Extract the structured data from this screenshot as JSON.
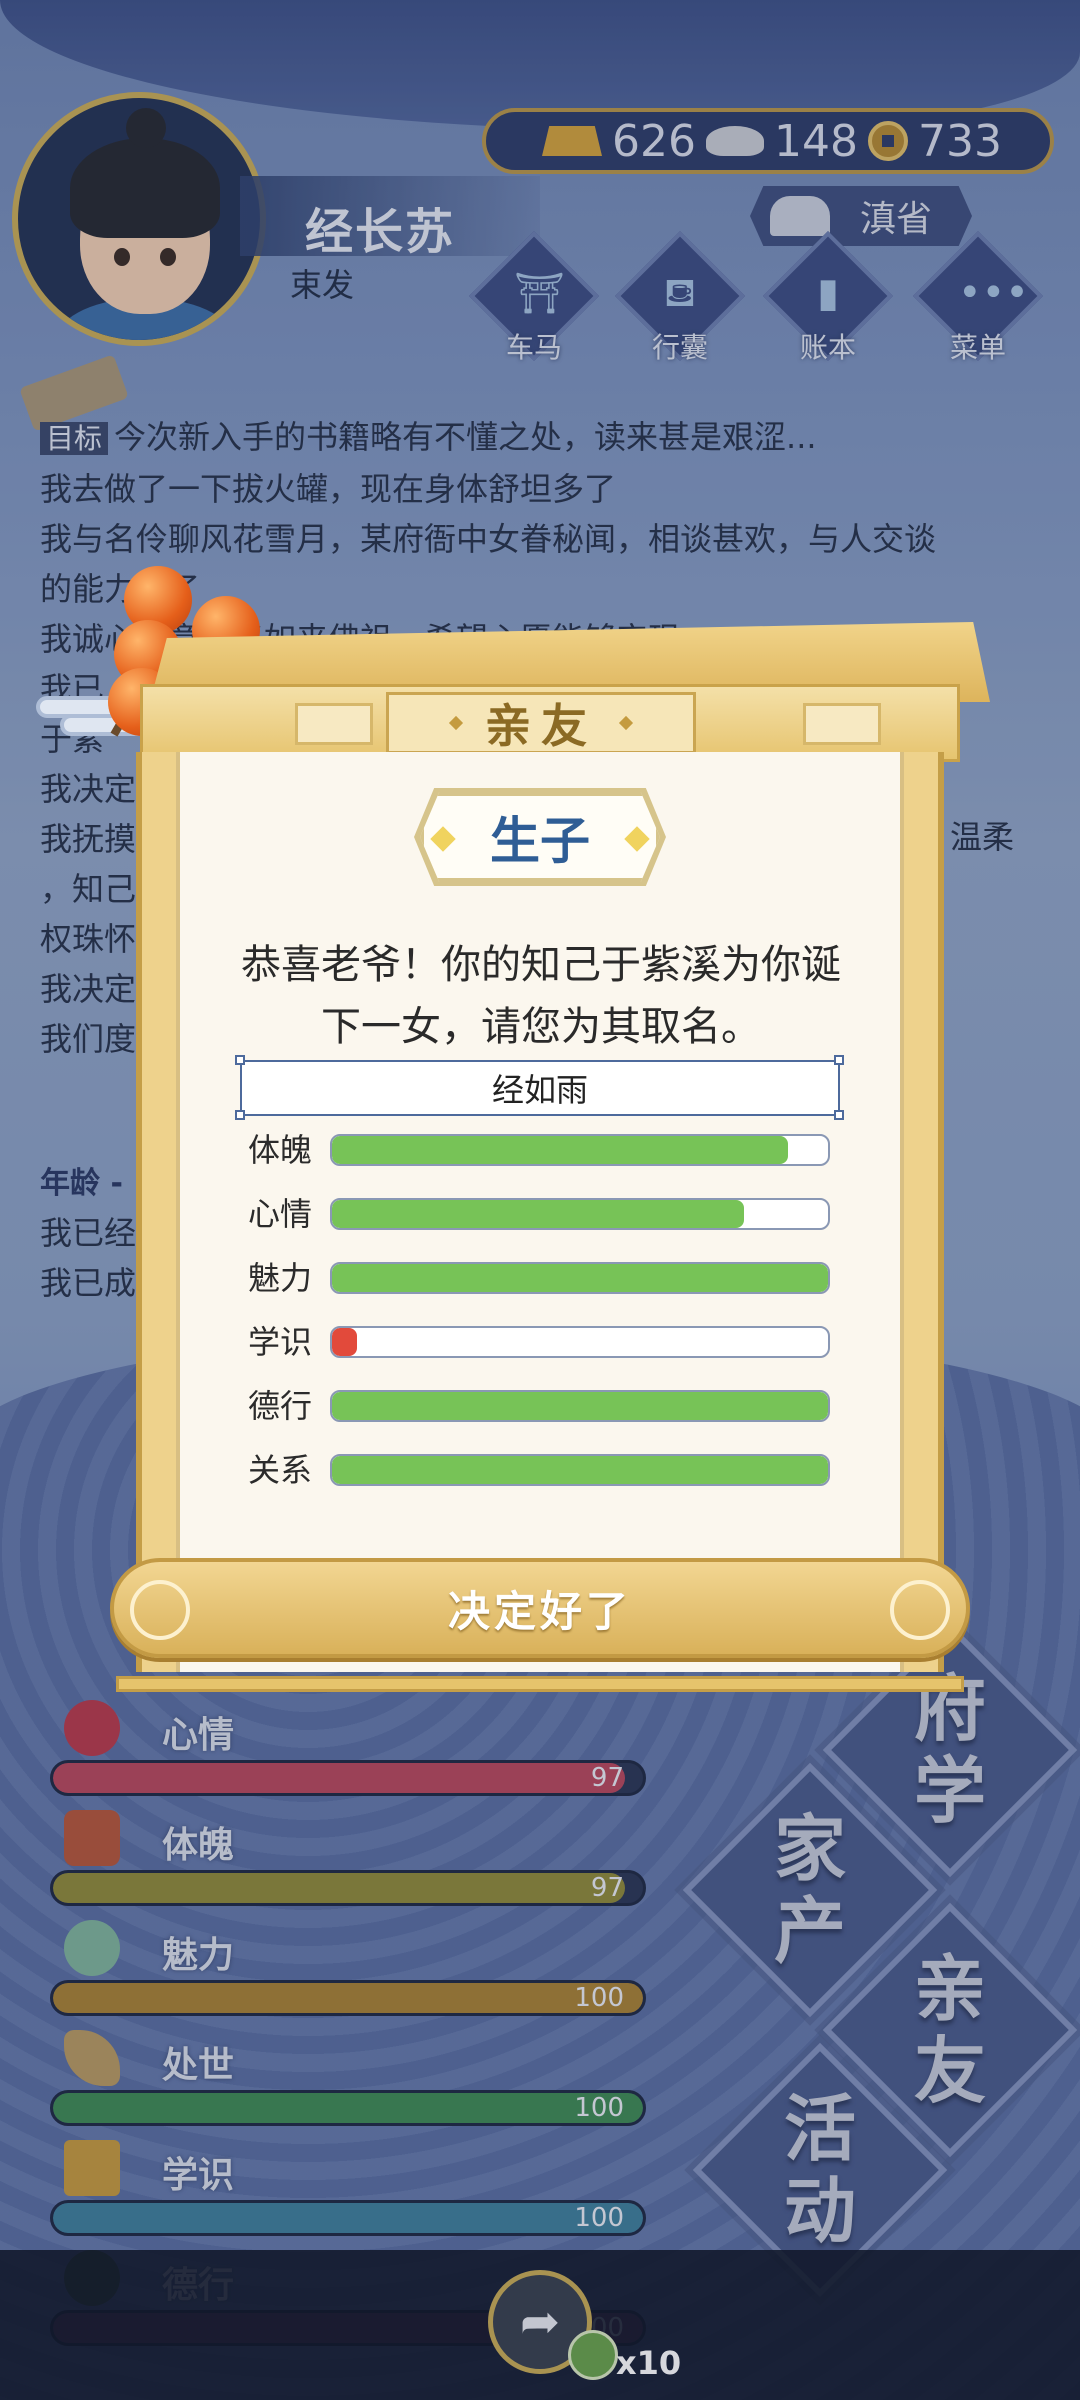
{
  "header": {
    "currency": [
      {
        "icon": "gold-ingot-icon",
        "value": "626"
      },
      {
        "icon": "silver-ingot-icon",
        "value": "148"
      },
      {
        "icon": "copper-coin-icon",
        "value": "733"
      }
    ],
    "character_name": "经长苏",
    "character_subtitle": "束发",
    "region": "滇省",
    "menu_buttons": [
      {
        "label": "车马",
        "icon": "carriage-icon"
      },
      {
        "label": "行囊",
        "icon": "bag-icon"
      },
      {
        "label": "账本",
        "icon": "ledger-icon"
      },
      {
        "label": "菜单",
        "icon": "more-icon"
      }
    ]
  },
  "log": {
    "goal_tag": "目标",
    "lines": [
      "今次新入手的书籍略有不懂之处，读来甚是艰涩...",
      "我去做了一下拔火罐，现在身体舒坦多了",
      "我与名伶聊风花雪月，某府衙中女眷秘闻，相谈甚欢，与人交谈",
      "的能力长了",
      "我诚心诚意拜了如来佛祖，希望心愿能够实现",
      "我已",
      "于紫",
      "我决定",
      "我抚摸",
      "，知己",
      "权珠怀",
      "我决定",
      "我们度"
    ],
    "right_fragment": "温柔",
    "age_heading": "年龄 -",
    "lines2": [
      "我已经",
      "我已成"
    ]
  },
  "stats": [
    {
      "label": "心情",
      "value": "97",
      "percent": 97,
      "color": "#b8485d",
      "icon": "flower-icon"
    },
    {
      "label": "体魄",
      "value": "97",
      "percent": 97,
      "color": "#8f8a3a",
      "icon": "figure-icon"
    },
    {
      "label": "魅力",
      "value": "100",
      "percent": 100,
      "color": "#a88235",
      "icon": "jade-icon"
    },
    {
      "label": "处世",
      "value": "100",
      "percent": 100,
      "color": "#3f8a55",
      "icon": "fan-icon"
    },
    {
      "label": "学识",
      "value": "100",
      "percent": 100,
      "color": "#3f7f9c",
      "icon": "books-icon"
    },
    {
      "label": "德行",
      "value": "100",
      "percent": 100,
      "color": "#6a3b6e",
      "icon": "brush-icon"
    }
  ],
  "nav": [
    {
      "line1": "府",
      "line2": "学"
    },
    {
      "line1": "家",
      "line2": "产"
    },
    {
      "line1": "亲",
      "line2": "友"
    },
    {
      "line1": "活",
      "line2": "动"
    }
  ],
  "share": {
    "count": "x10"
  },
  "modal": {
    "title": "亲友",
    "event": "生子",
    "message_line1": "恭喜老爷！你的知己于紫溪为你诞",
    "message_line2": "下一女，请您为其取名。",
    "name_value": "经如雨",
    "attributes": [
      {
        "label": "体魄",
        "percent": 92,
        "color": "#77c357"
      },
      {
        "label": "心情",
        "percent": 83,
        "color": "#77c357"
      },
      {
        "label": "魅力",
        "percent": 100,
        "color": "#77c357"
      },
      {
        "label": "学识",
        "percent": 5,
        "color": "#e24a3b"
      },
      {
        "label": "德行",
        "percent": 100,
        "color": "#77c357"
      },
      {
        "label": "关系",
        "percent": 100,
        "color": "#77c357"
      }
    ],
    "confirm_label": "决定好了"
  }
}
